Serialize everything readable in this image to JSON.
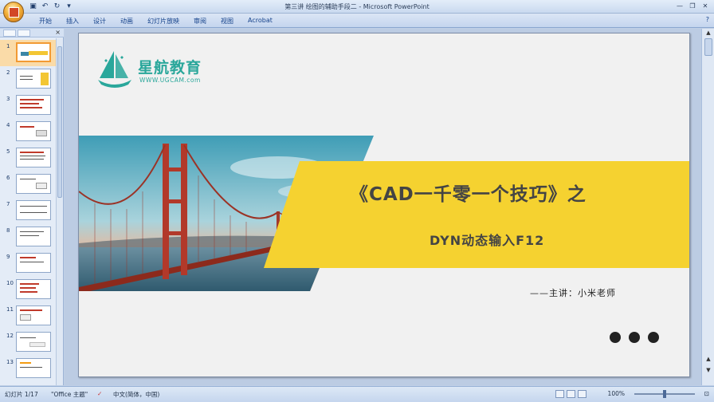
{
  "window": {
    "title": "第三讲 绘图的辅助手段二 - Microsoft PowerPoint"
  },
  "quick_access": {
    "save_icon": "save-icon",
    "undo_icon": "undo-icon",
    "redo_icon": "redo-icon"
  },
  "ribbon": {
    "tabs": [
      "开始",
      "插入",
      "设计",
      "动画",
      "幻灯片放映",
      "审阅",
      "视图",
      "Acrobat"
    ]
  },
  "slide_panel": {
    "numbers": [
      "1",
      "2",
      "3",
      "4",
      "5",
      "6",
      "7",
      "8",
      "9",
      "10",
      "11",
      "12",
      "13"
    ],
    "selected": "1"
  },
  "slide": {
    "brand_name": "星航教育",
    "brand_url": "WWW.UGCAM.com",
    "title": "《CAD一千零一个技巧》之",
    "subtitle": "DYN动态输入F12",
    "presenter": "——主讲：小米老师",
    "accent_color": "#f5d230",
    "brand_color": "#2aa79b"
  },
  "status": {
    "slide_info": "幻灯片 1/17",
    "theme": "\"Office 主题\"",
    "language": "中文(简体，中国)",
    "zoom": "100%"
  }
}
